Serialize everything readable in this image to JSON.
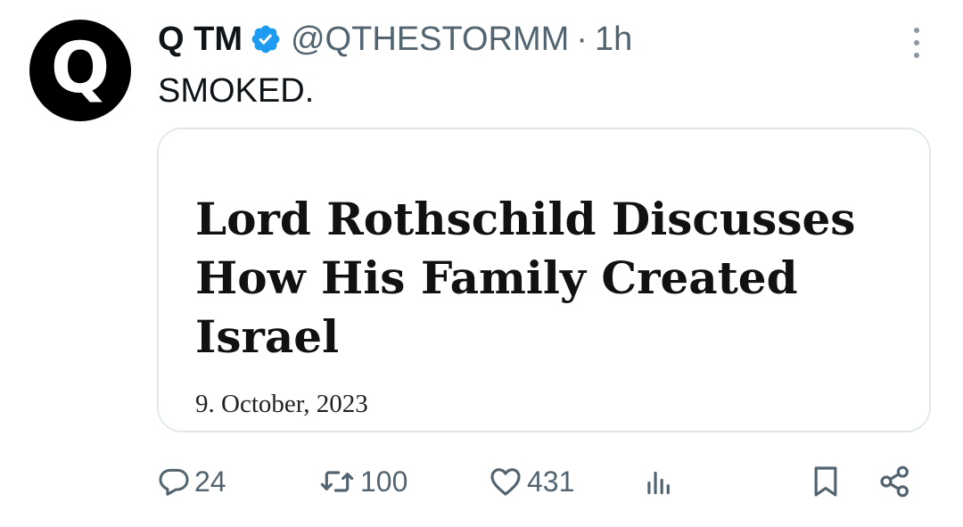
{
  "tweet": {
    "avatar_letter": "Q",
    "display_name": "Q TM",
    "handle": "@QTHESTORMM",
    "separator": "·",
    "time": "1h",
    "text": "SMOKED."
  },
  "card": {
    "title": "Lord Rothschild Discusses How His Family Created Israel",
    "date": "9. October, 2023"
  },
  "actions": {
    "replies": "24",
    "reposts": "100",
    "likes": "431"
  },
  "colors": {
    "verified": "#1d9bf0",
    "secondary_text": "#536471",
    "primary_text": "#0f1419",
    "card_border": "#e1e8ed"
  },
  "icons": [
    "verified-badge-icon",
    "more-icon",
    "reply-icon",
    "repost-icon",
    "like-icon",
    "views-icon",
    "bookmark-icon",
    "share-icon"
  ]
}
